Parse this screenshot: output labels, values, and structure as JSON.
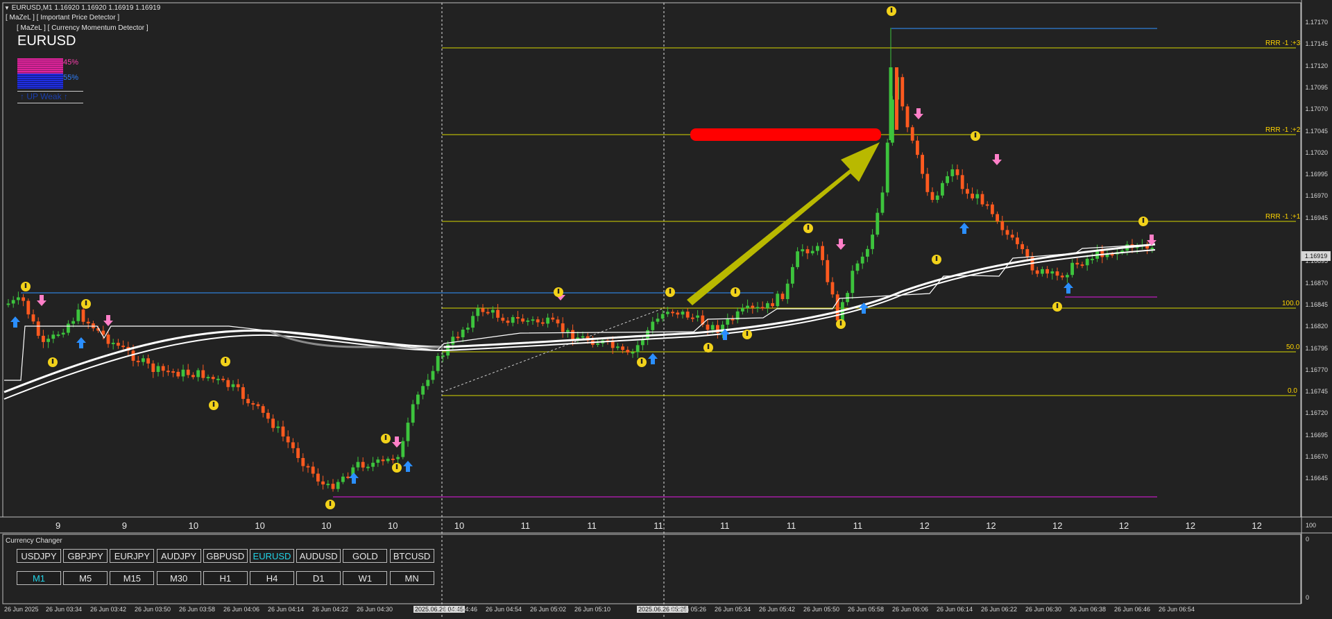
{
  "header": {
    "symbol_line": "EURUSD,M1  1.16920 1.16920 1.16919 1.16919",
    "indicator1": "[ MaZeL ] [ Important Price Detector ]",
    "indicator2": "[ MaZeL ] [ Currency Momentum Detector ]",
    "symbol": "EURUSD",
    "strength_up": "45%",
    "strength_down": "55%",
    "trend_text": "UP Weak"
  },
  "levels": {
    "rrr3": "RRR -1 :+3",
    "rrr2": "RRR -1 :+2",
    "rrr1": "RRR -1 :+1",
    "fib100": "100.0",
    "fib50": "50.0",
    "fib0": "0.0"
  },
  "price_axis": [
    "1.17170",
    "1.17145",
    "1.17120",
    "1.17095",
    "1.17070",
    "1.17045",
    "1.17020",
    "1.16995",
    "1.16970",
    "1.16945",
    "1.16919",
    "1.16895",
    "1.16870",
    "1.16845",
    "1.16820",
    "1.16795",
    "1.16770",
    "1.16745",
    "1.16720",
    "1.16695",
    "1.16670",
    "1.16645"
  ],
  "current_price": "1.16919",
  "day_labels": [
    "9",
    "9",
    "10",
    "10",
    "10",
    "10",
    "10",
    "11",
    "11",
    "11",
    "11",
    "11",
    "11",
    "12",
    "12",
    "12",
    "12",
    "12",
    "12"
  ],
  "time_labels": [
    "26 Jun 2025",
    "26 Jun 03:34",
    "26 Jun 03:42",
    "26 Jun 03:50",
    "26 Jun 03:58",
    "26 Jun 04:06",
    "26 Jun 04:14",
    "26 Jun 04:22",
    "26 Jun 04:30",
    "2025.06.26 04:45",
    "26 Jun 04:46",
    "26 Jun 04:54",
    "26 Jun 05:02",
    "26 Jun 05:10",
    "2025.06.26 05:25",
    "26 Jun 05:26",
    "26 Jun 05:34",
    "26 Jun 05:42",
    "26 Jun 05:50",
    "26 Jun 05:58",
    "26 Jun 06:06",
    "26 Jun 06:14",
    "26 Jun 06:22",
    "26 Jun 06:30",
    "26 Jun 06:38",
    "26 Jun 06:46",
    "26 Jun 06:54"
  ],
  "subwindow": {
    "title": "Currency Changer",
    "axis_top": "100",
    "axis_mid": "0",
    "axis_bottom": "0",
    "symbols": [
      "USDJPY",
      "GBPJPY",
      "EURJPY",
      "AUDJPY",
      "GBPUSD",
      "EURUSD",
      "AUDUSD",
      "GOLD",
      "BTCUSD"
    ],
    "active_symbol": "EURUSD",
    "timeframes": [
      "M1",
      "M5",
      "M15",
      "M30",
      "H1",
      "H4",
      "D1",
      "W1",
      "MN"
    ],
    "active_timeframe": "M1"
  },
  "colors": {
    "background": "#222222",
    "bull_candle": "#3dc43d",
    "bear_candle": "#ff5a1f",
    "level_line": "#d8d800",
    "blue_line": "#2f7fd8",
    "magenta_line": "#c01cc0",
    "buy_arrow": "#2b8fff",
    "sell_arrow": "#ff7fc8",
    "active_button_text": "#22d3e6"
  }
}
